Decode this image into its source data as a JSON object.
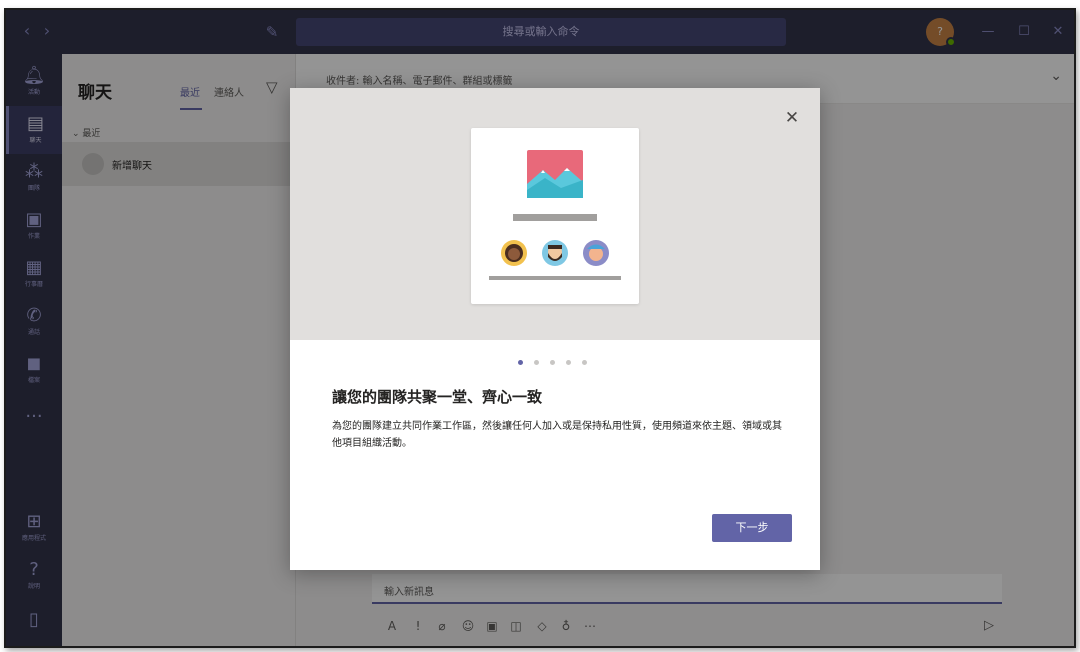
{
  "titlebar": {
    "search_placeholder": "搜尋或輸入命令",
    "avatar_initial": "?",
    "back_icon": "chevron-left",
    "forward_icon": "chevron-right",
    "compose_icon": "new-chat",
    "minimize_icon": "minimize",
    "maximize_icon": "maximize",
    "close_icon": "close"
  },
  "rail": {
    "items": [
      {
        "label": "活動",
        "icon": "bell"
      },
      {
        "label": "聊天",
        "icon": "chat"
      },
      {
        "label": "團隊",
        "icon": "teams"
      },
      {
        "label": "作業",
        "icon": "assignments"
      },
      {
        "label": "行事曆",
        "icon": "calendar"
      },
      {
        "label": "通話",
        "icon": "phone"
      },
      {
        "label": "檔案",
        "icon": "files"
      },
      {
        "label": "...",
        "icon": "more"
      }
    ],
    "bottom": [
      {
        "label": "應用程式",
        "icon": "apps"
      },
      {
        "label": "說明",
        "icon": "help"
      }
    ],
    "device_icon": "device"
  },
  "chatlist": {
    "title": "聊天",
    "tabs": [
      "最近",
      "連絡人"
    ],
    "section": "最近",
    "chat_name": "新增聊天"
  },
  "main": {
    "to_label": "收件者: 輸入名稱、電子郵件、群組或標籤",
    "composer_placeholder": "輸入新訊息"
  },
  "modal": {
    "title": "讓您的團隊共聚一堂、齊心一致",
    "description": "為您的團隊建立共同作業工作區，然後讓任何人加入或是保持私用性質，使用頻道來依主題、領域或其他項目組織活動。",
    "next_label": "下一步",
    "pagination": {
      "total": 5,
      "current": 1
    }
  },
  "colors": {
    "brand": "#6264a7",
    "rail": "#33344a",
    "search": "#464775"
  }
}
